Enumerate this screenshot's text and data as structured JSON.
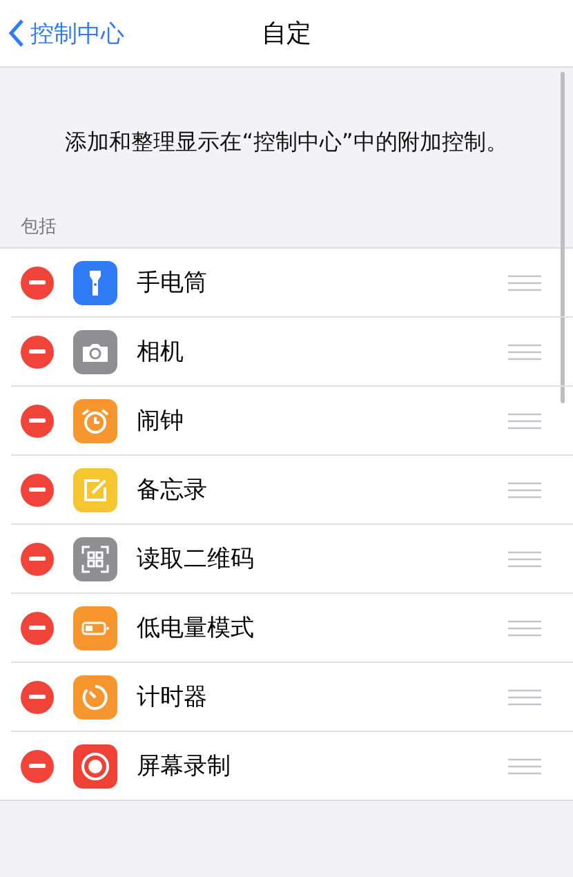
{
  "nav": {
    "back": "控制中心",
    "title": "自定"
  },
  "description": "添加和整理显示在“控制中心”中的附加控制。",
  "section": {
    "header": "包括",
    "items": [
      {
        "label": "手电筒",
        "kind": "flashlight",
        "color": "#2f7cf6"
      },
      {
        "label": "相机",
        "kind": "camera",
        "color": "#8e8e93"
      },
      {
        "label": "闹钟",
        "kind": "alarm",
        "color": "#f7962f"
      },
      {
        "label": "备忘录",
        "kind": "notes",
        "color": "#f6c631"
      },
      {
        "label": "读取二维码",
        "kind": "qr",
        "color": "#8e8e93"
      },
      {
        "label": "低电量模式",
        "kind": "battery",
        "color": "#f7962f"
      },
      {
        "label": "计时器",
        "kind": "timer",
        "color": "#f7962f"
      },
      {
        "label": "屏幕录制",
        "kind": "record",
        "color": "#ef4136"
      }
    ]
  }
}
